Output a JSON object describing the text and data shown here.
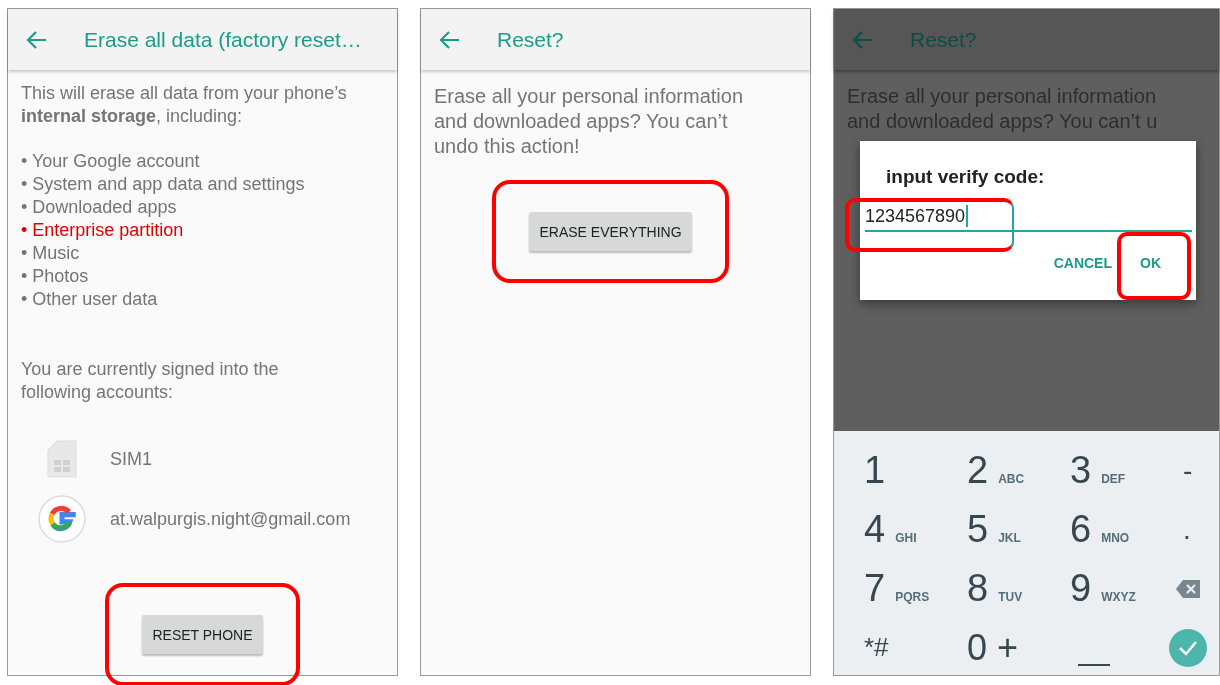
{
  "panels": [
    {
      "kind": "info",
      "header": {
        "title": "Erase all data (factory reset…"
      },
      "intro": "This will erase all data from your phone’s **internal storage**, including:",
      "items": [
        {
          "text": "• Your Google account",
          "warning": false
        },
        {
          "text": "• System and app data and settings",
          "warning": false
        },
        {
          "text": "• Downloaded apps",
          "warning": false
        },
        {
          "text": "• Enterprise partition",
          "warning": true
        },
        {
          "text": "• Music",
          "warning": false
        },
        {
          "text": "• Photos",
          "warning": false
        },
        {
          "text": "• Other user data",
          "warning": false
        }
      ],
      "accounts_note": "You are currently signed into the following accounts:",
      "accounts": [
        {
          "kind": "sim",
          "name": "SIM1"
        },
        {
          "kind": "google",
          "name": "at.walpurgis.night@gmail.com"
        }
      ],
      "button": {
        "label": "RESET PHONE",
        "highlighted": true
      }
    },
    {
      "kind": "confirm",
      "header": {
        "title": "Reset?"
      },
      "message": "Erase all your personal information and downloaded apps? You can’t undo this action!",
      "button": {
        "label": "ERASE EVERYTHING",
        "highlighted": true
      }
    },
    {
      "kind": "dialog",
      "header": {
        "title": "Reset?"
      },
      "message": "Erase all your personal information and downloaded apps? You can’t u",
      "dialog": {
        "title": "input verify code:",
        "field": {
          "value": "1234567890",
          "highlighted": true
        },
        "buttons": [
          {
            "label": "CANCEL",
            "highlighted": false
          },
          {
            "label": "OK",
            "highlighted": true
          }
        ]
      },
      "keypad": [
        {
          "kind": "digit",
          "main": "1"
        },
        {
          "kind": "digit",
          "main": "2",
          "sub": "ABC"
        },
        {
          "kind": "digit",
          "main": "3",
          "sub": "DEF"
        },
        {
          "kind": "symbol",
          "main": "-"
        },
        {
          "kind": "digit",
          "main": "4",
          "sub": "GHI"
        },
        {
          "kind": "digit",
          "main": "5",
          "sub": "JKL"
        },
        {
          "kind": "digit",
          "main": "6",
          "sub": "MNO"
        },
        {
          "kind": "symbol",
          "main": "."
        },
        {
          "kind": "digit",
          "main": "7",
          "sub": "PQRS"
        },
        {
          "kind": "digit",
          "main": "8",
          "sub": "TUV"
        },
        {
          "kind": "digit",
          "main": "9",
          "sub": "WXYZ"
        },
        {
          "kind": "backspace"
        },
        {
          "kind": "small",
          "main": "*#"
        },
        {
          "kind": "large",
          "main": "0 +"
        },
        {
          "kind": "space"
        },
        {
          "kind": "done"
        }
      ]
    }
  ]
}
